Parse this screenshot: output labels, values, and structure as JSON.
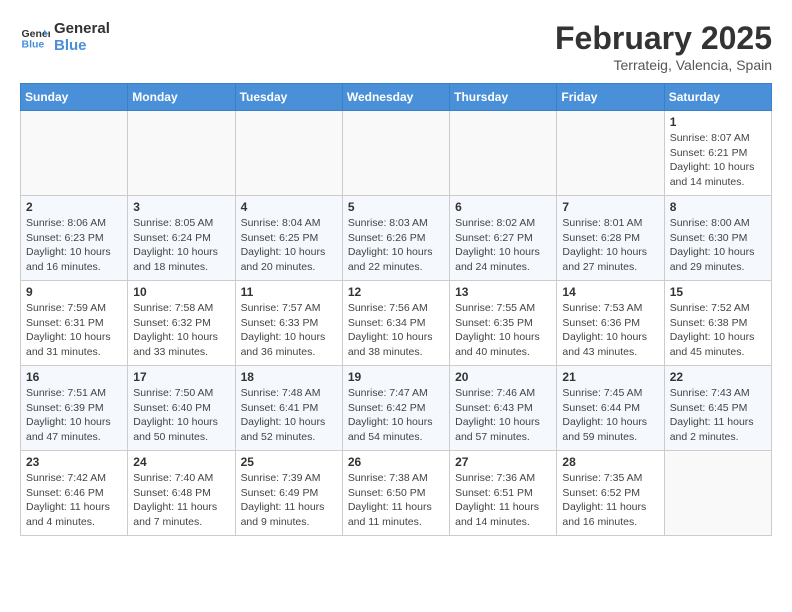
{
  "logo": {
    "line1": "General",
    "line2": "Blue"
  },
  "title": "February 2025",
  "subtitle": "Terrateig, Valencia, Spain",
  "weekdays": [
    "Sunday",
    "Monday",
    "Tuesday",
    "Wednesday",
    "Thursday",
    "Friday",
    "Saturday"
  ],
  "weeks": [
    [
      {
        "day": "",
        "info": ""
      },
      {
        "day": "",
        "info": ""
      },
      {
        "day": "",
        "info": ""
      },
      {
        "day": "",
        "info": ""
      },
      {
        "day": "",
        "info": ""
      },
      {
        "day": "",
        "info": ""
      },
      {
        "day": "1",
        "info": "Sunrise: 8:07 AM\nSunset: 6:21 PM\nDaylight: 10 hours\nand 14 minutes."
      }
    ],
    [
      {
        "day": "2",
        "info": "Sunrise: 8:06 AM\nSunset: 6:23 PM\nDaylight: 10 hours\nand 16 minutes."
      },
      {
        "day": "3",
        "info": "Sunrise: 8:05 AM\nSunset: 6:24 PM\nDaylight: 10 hours\nand 18 minutes."
      },
      {
        "day": "4",
        "info": "Sunrise: 8:04 AM\nSunset: 6:25 PM\nDaylight: 10 hours\nand 20 minutes."
      },
      {
        "day": "5",
        "info": "Sunrise: 8:03 AM\nSunset: 6:26 PM\nDaylight: 10 hours\nand 22 minutes."
      },
      {
        "day": "6",
        "info": "Sunrise: 8:02 AM\nSunset: 6:27 PM\nDaylight: 10 hours\nand 24 minutes."
      },
      {
        "day": "7",
        "info": "Sunrise: 8:01 AM\nSunset: 6:28 PM\nDaylight: 10 hours\nand 27 minutes."
      },
      {
        "day": "8",
        "info": "Sunrise: 8:00 AM\nSunset: 6:30 PM\nDaylight: 10 hours\nand 29 minutes."
      }
    ],
    [
      {
        "day": "9",
        "info": "Sunrise: 7:59 AM\nSunset: 6:31 PM\nDaylight: 10 hours\nand 31 minutes."
      },
      {
        "day": "10",
        "info": "Sunrise: 7:58 AM\nSunset: 6:32 PM\nDaylight: 10 hours\nand 33 minutes."
      },
      {
        "day": "11",
        "info": "Sunrise: 7:57 AM\nSunset: 6:33 PM\nDaylight: 10 hours\nand 36 minutes."
      },
      {
        "day": "12",
        "info": "Sunrise: 7:56 AM\nSunset: 6:34 PM\nDaylight: 10 hours\nand 38 minutes."
      },
      {
        "day": "13",
        "info": "Sunrise: 7:55 AM\nSunset: 6:35 PM\nDaylight: 10 hours\nand 40 minutes."
      },
      {
        "day": "14",
        "info": "Sunrise: 7:53 AM\nSunset: 6:36 PM\nDaylight: 10 hours\nand 43 minutes."
      },
      {
        "day": "15",
        "info": "Sunrise: 7:52 AM\nSunset: 6:38 PM\nDaylight: 10 hours\nand 45 minutes."
      }
    ],
    [
      {
        "day": "16",
        "info": "Sunrise: 7:51 AM\nSunset: 6:39 PM\nDaylight: 10 hours\nand 47 minutes."
      },
      {
        "day": "17",
        "info": "Sunrise: 7:50 AM\nSunset: 6:40 PM\nDaylight: 10 hours\nand 50 minutes."
      },
      {
        "day": "18",
        "info": "Sunrise: 7:48 AM\nSunset: 6:41 PM\nDaylight: 10 hours\nand 52 minutes."
      },
      {
        "day": "19",
        "info": "Sunrise: 7:47 AM\nSunset: 6:42 PM\nDaylight: 10 hours\nand 54 minutes."
      },
      {
        "day": "20",
        "info": "Sunrise: 7:46 AM\nSunset: 6:43 PM\nDaylight: 10 hours\nand 57 minutes."
      },
      {
        "day": "21",
        "info": "Sunrise: 7:45 AM\nSunset: 6:44 PM\nDaylight: 10 hours\nand 59 minutes."
      },
      {
        "day": "22",
        "info": "Sunrise: 7:43 AM\nSunset: 6:45 PM\nDaylight: 11 hours\nand 2 minutes."
      }
    ],
    [
      {
        "day": "23",
        "info": "Sunrise: 7:42 AM\nSunset: 6:46 PM\nDaylight: 11 hours\nand 4 minutes."
      },
      {
        "day": "24",
        "info": "Sunrise: 7:40 AM\nSunset: 6:48 PM\nDaylight: 11 hours\nand 7 minutes."
      },
      {
        "day": "25",
        "info": "Sunrise: 7:39 AM\nSunset: 6:49 PM\nDaylight: 11 hours\nand 9 minutes."
      },
      {
        "day": "26",
        "info": "Sunrise: 7:38 AM\nSunset: 6:50 PM\nDaylight: 11 hours\nand 11 minutes."
      },
      {
        "day": "27",
        "info": "Sunrise: 7:36 AM\nSunset: 6:51 PM\nDaylight: 11 hours\nand 14 minutes."
      },
      {
        "day": "28",
        "info": "Sunrise: 7:35 AM\nSunset: 6:52 PM\nDaylight: 11 hours\nand 16 minutes."
      },
      {
        "day": "",
        "info": ""
      }
    ]
  ]
}
